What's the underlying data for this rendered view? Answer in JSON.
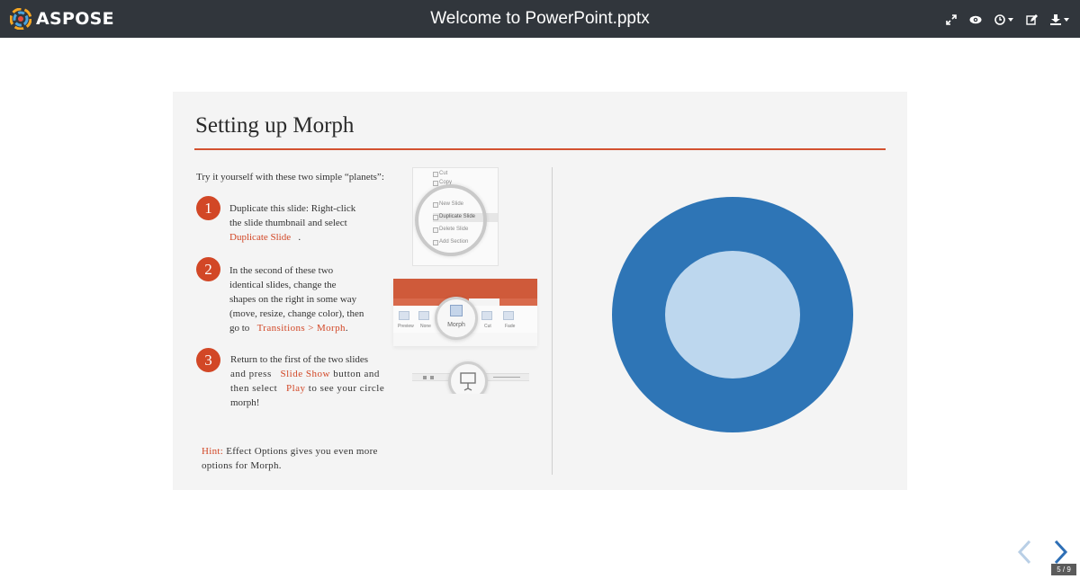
{
  "app": {
    "brand": "ASPOSE",
    "document_title": "Welcome to PowerPoint.pptx",
    "toolbar": {
      "fullscreen_icon": "expand-arrows-icon",
      "view_icon": "eye-icon",
      "history_icon": "clock-icon",
      "edit_icon": "edit-icon",
      "download_icon": "download-icon"
    }
  },
  "slide": {
    "title": "Setting up Morph",
    "intro": "Try it yourself with these two simple “planets”:",
    "steps": [
      {
        "number": "1",
        "text_1": "Duplicate this slide: Right-click",
        "text_2": "the slide thumbnail and select",
        "accent": "Duplicate Slide",
        "tail": "."
      },
      {
        "number": "2",
        "text_1": "In the second of these two",
        "text_2": "identical slides, change the",
        "text_3": "shapes on the right in some way",
        "text_4": "(move, resize, change color), then",
        "text_5": "go to",
        "accent": "Transitions > Morph",
        "tail": "."
      },
      {
        "number": "3",
        "text_1": "Return to the first of the two slides",
        "text_2": "and press",
        "accent_1": "Slide Show",
        "text_3": "button and",
        "text_4": "then select",
        "accent_2": "Play",
        "text_5": "to see your circle",
        "text_6": "morph!"
      }
    ],
    "hint_label": "Hint:",
    "hint_text_1": "Effect Options gives you even more",
    "hint_text_2": "options for Morph.",
    "screenshot_menu": {
      "items": [
        "Cut",
        "Copy",
        "New Slide",
        "Duplicate Slide",
        "Delete Slide",
        "Add Section"
      ]
    },
    "screenshot_ribbon": {
      "morph_label": "Morph",
      "tab_label": "Transitions",
      "other_labels": [
        "Preview",
        "None",
        "Cut",
        "Fade"
      ]
    },
    "colors": {
      "accent": "#d24726",
      "donut_outer": "#2e75b6",
      "donut_inner": "#bdd7ee"
    }
  },
  "navigation": {
    "prev_icon": "chevron-left-icon",
    "next_icon": "chevron-right-icon",
    "page_indicator": "5 / 9"
  }
}
